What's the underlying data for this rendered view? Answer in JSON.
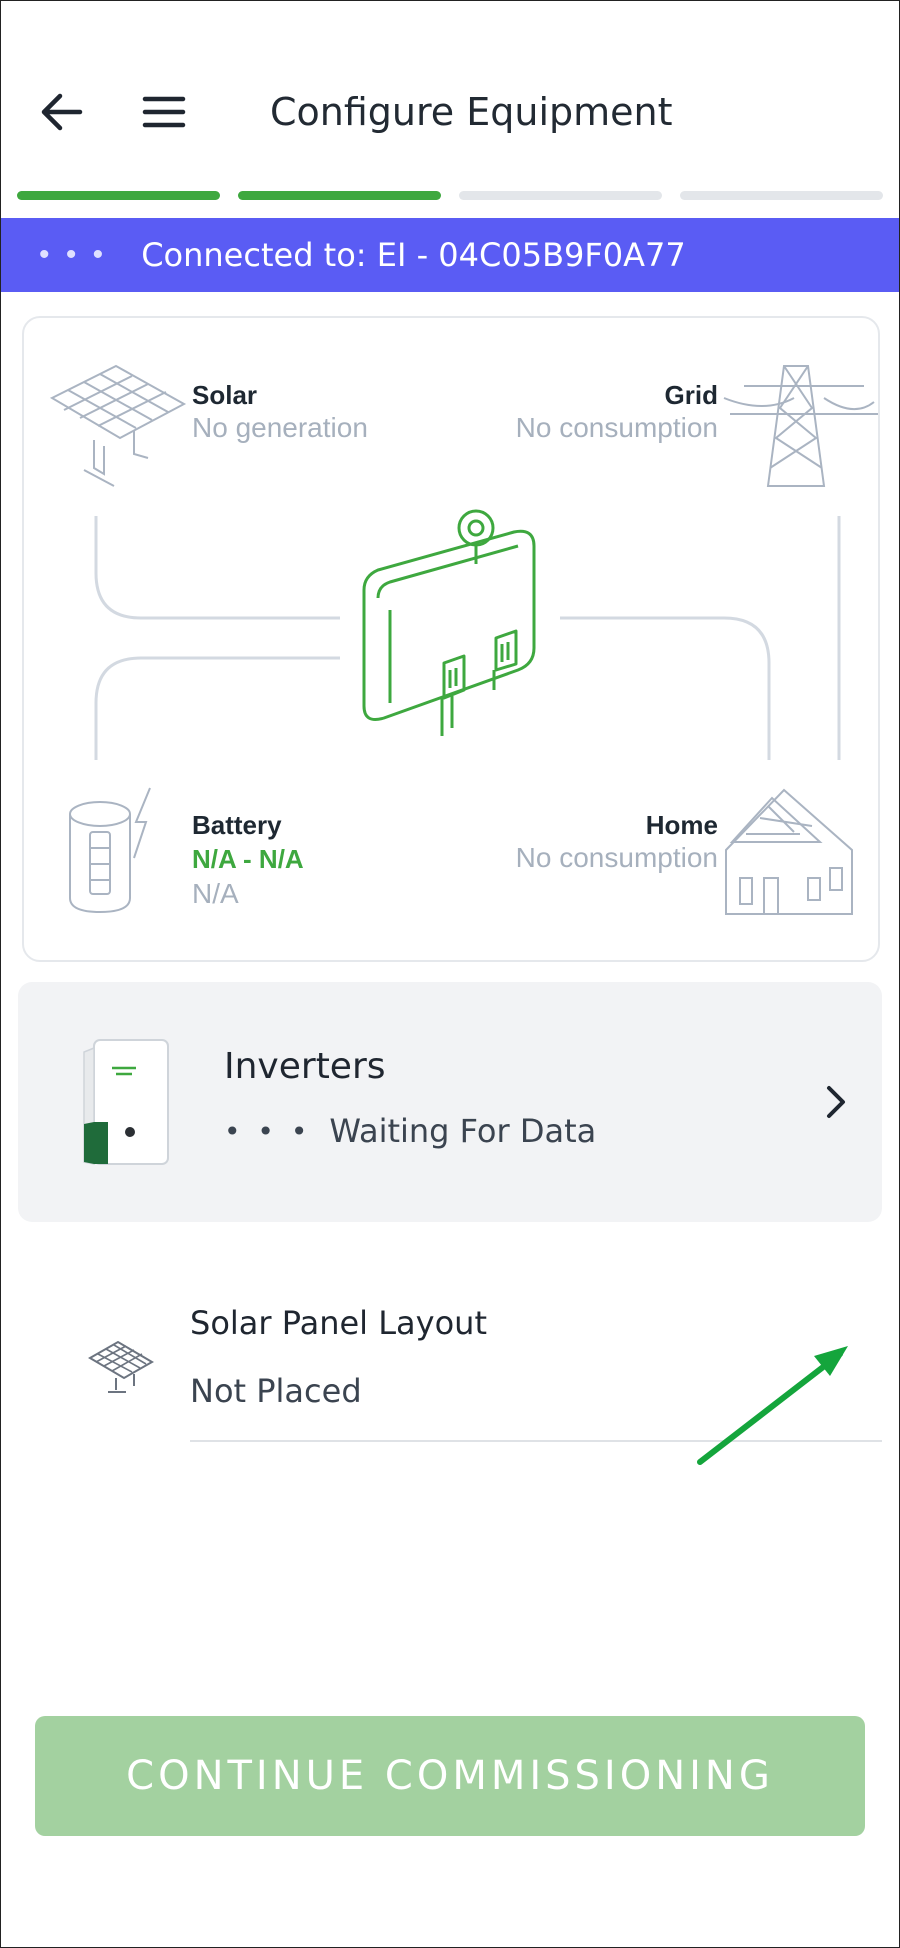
{
  "header": {
    "title": "Configure Equipment",
    "back_icon": "arrow-left-icon",
    "menu_icon": "hamburger-menu-icon"
  },
  "progress": {
    "total_steps": 4,
    "completed_steps": 2
  },
  "banner": {
    "dots": "• • •",
    "text": "Connected to: EI - 04C05B9F0A77",
    "color": "#5a5cf4"
  },
  "energy_flow": {
    "solar": {
      "title": "Solar",
      "status": "No generation"
    },
    "grid": {
      "title": "Grid",
      "status": "No consumption"
    },
    "battery": {
      "title": "Battery",
      "value": "N/A - N/A",
      "status": "N/A"
    },
    "home": {
      "title": "Home",
      "status": "No consumption"
    }
  },
  "inverters": {
    "title": "Inverters",
    "dots": "• • •",
    "status": "Waiting For Data"
  },
  "solar_layout": {
    "title": "Solar Panel Layout",
    "status": "Not Placed"
  },
  "continue_button": {
    "label": "CONTINUE COMMISSIONING"
  },
  "colors": {
    "accent_green": "#3ea83f",
    "banner": "#5a5cf4",
    "button_disabled": "#a3d1a0"
  }
}
